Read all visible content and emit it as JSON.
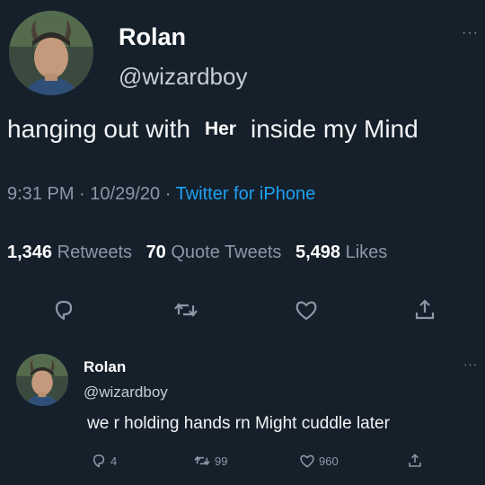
{
  "tweet": {
    "author_name": "Rolan",
    "handle": "@wizardboy",
    "more": "···",
    "text_before": "hanging out with",
    "text_highlight": "Her",
    "text_after": "inside my Mind",
    "time": "9:31 PM",
    "date": "10/29/20",
    "sep": "·",
    "source": "Twitter for iPhone",
    "stats": {
      "retweets_count": "1,346",
      "retweets_label": "Retweets",
      "quote_count": "70",
      "quote_label": "Quote Tweets",
      "likes_count": "5,498",
      "likes_label": "Likes"
    }
  },
  "reply": {
    "author_name": "Rolan",
    "handle": "@wizardboy",
    "more": "···",
    "text": "we r holding hands rn  Might cuddle later",
    "reply_count": "4",
    "retweet_count": "99",
    "like_count": "960"
  },
  "colors": {
    "background": "#15202b",
    "link": "#1da1f2",
    "muted": "#8b98a5"
  },
  "icons": [
    "avatar",
    "reply-icon",
    "retweet-icon",
    "like-icon",
    "share-icon"
  ]
}
